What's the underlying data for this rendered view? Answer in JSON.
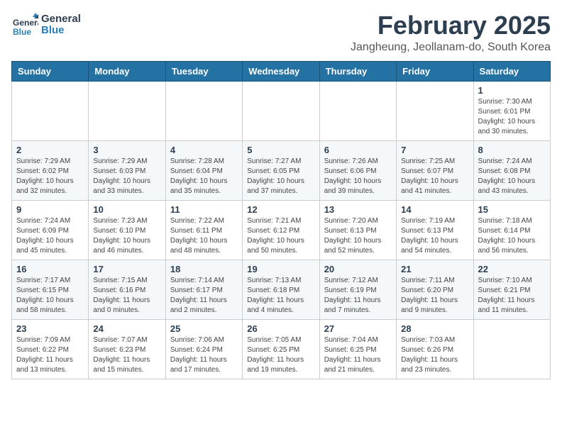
{
  "header": {
    "logo_general": "General",
    "logo_blue": "Blue",
    "month_title": "February 2025",
    "location": "Jangheung, Jeollanam-do, South Korea"
  },
  "days_of_week": [
    "Sunday",
    "Monday",
    "Tuesday",
    "Wednesday",
    "Thursday",
    "Friday",
    "Saturday"
  ],
  "weeks": [
    [
      {
        "day": "",
        "info": ""
      },
      {
        "day": "",
        "info": ""
      },
      {
        "day": "",
        "info": ""
      },
      {
        "day": "",
        "info": ""
      },
      {
        "day": "",
        "info": ""
      },
      {
        "day": "",
        "info": ""
      },
      {
        "day": "1",
        "info": "Sunrise: 7:30 AM\nSunset: 6:01 PM\nDaylight: 10 hours and 30 minutes."
      }
    ],
    [
      {
        "day": "2",
        "info": "Sunrise: 7:29 AM\nSunset: 6:02 PM\nDaylight: 10 hours and 32 minutes."
      },
      {
        "day": "3",
        "info": "Sunrise: 7:29 AM\nSunset: 6:03 PM\nDaylight: 10 hours and 33 minutes."
      },
      {
        "day": "4",
        "info": "Sunrise: 7:28 AM\nSunset: 6:04 PM\nDaylight: 10 hours and 35 minutes."
      },
      {
        "day": "5",
        "info": "Sunrise: 7:27 AM\nSunset: 6:05 PM\nDaylight: 10 hours and 37 minutes."
      },
      {
        "day": "6",
        "info": "Sunrise: 7:26 AM\nSunset: 6:06 PM\nDaylight: 10 hours and 39 minutes."
      },
      {
        "day": "7",
        "info": "Sunrise: 7:25 AM\nSunset: 6:07 PM\nDaylight: 10 hours and 41 minutes."
      },
      {
        "day": "8",
        "info": "Sunrise: 7:24 AM\nSunset: 6:08 PM\nDaylight: 10 hours and 43 minutes."
      }
    ],
    [
      {
        "day": "9",
        "info": "Sunrise: 7:24 AM\nSunset: 6:09 PM\nDaylight: 10 hours and 45 minutes."
      },
      {
        "day": "10",
        "info": "Sunrise: 7:23 AM\nSunset: 6:10 PM\nDaylight: 10 hours and 46 minutes."
      },
      {
        "day": "11",
        "info": "Sunrise: 7:22 AM\nSunset: 6:11 PM\nDaylight: 10 hours and 48 minutes."
      },
      {
        "day": "12",
        "info": "Sunrise: 7:21 AM\nSunset: 6:12 PM\nDaylight: 10 hours and 50 minutes."
      },
      {
        "day": "13",
        "info": "Sunrise: 7:20 AM\nSunset: 6:13 PM\nDaylight: 10 hours and 52 minutes."
      },
      {
        "day": "14",
        "info": "Sunrise: 7:19 AM\nSunset: 6:13 PM\nDaylight: 10 hours and 54 minutes."
      },
      {
        "day": "15",
        "info": "Sunrise: 7:18 AM\nSunset: 6:14 PM\nDaylight: 10 hours and 56 minutes."
      }
    ],
    [
      {
        "day": "16",
        "info": "Sunrise: 7:17 AM\nSunset: 6:15 PM\nDaylight: 10 hours and 58 minutes."
      },
      {
        "day": "17",
        "info": "Sunrise: 7:15 AM\nSunset: 6:16 PM\nDaylight: 11 hours and 0 minutes."
      },
      {
        "day": "18",
        "info": "Sunrise: 7:14 AM\nSunset: 6:17 PM\nDaylight: 11 hours and 2 minutes."
      },
      {
        "day": "19",
        "info": "Sunrise: 7:13 AM\nSunset: 6:18 PM\nDaylight: 11 hours and 4 minutes."
      },
      {
        "day": "20",
        "info": "Sunrise: 7:12 AM\nSunset: 6:19 PM\nDaylight: 11 hours and 7 minutes."
      },
      {
        "day": "21",
        "info": "Sunrise: 7:11 AM\nSunset: 6:20 PM\nDaylight: 11 hours and 9 minutes."
      },
      {
        "day": "22",
        "info": "Sunrise: 7:10 AM\nSunset: 6:21 PM\nDaylight: 11 hours and 11 minutes."
      }
    ],
    [
      {
        "day": "23",
        "info": "Sunrise: 7:09 AM\nSunset: 6:22 PM\nDaylight: 11 hours and 13 minutes."
      },
      {
        "day": "24",
        "info": "Sunrise: 7:07 AM\nSunset: 6:23 PM\nDaylight: 11 hours and 15 minutes."
      },
      {
        "day": "25",
        "info": "Sunrise: 7:06 AM\nSunset: 6:24 PM\nDaylight: 11 hours and 17 minutes."
      },
      {
        "day": "26",
        "info": "Sunrise: 7:05 AM\nSunset: 6:25 PM\nDaylight: 11 hours and 19 minutes."
      },
      {
        "day": "27",
        "info": "Sunrise: 7:04 AM\nSunset: 6:25 PM\nDaylight: 11 hours and 21 minutes."
      },
      {
        "day": "28",
        "info": "Sunrise: 7:03 AM\nSunset: 6:26 PM\nDaylight: 11 hours and 23 minutes."
      },
      {
        "day": "",
        "info": ""
      }
    ]
  ]
}
